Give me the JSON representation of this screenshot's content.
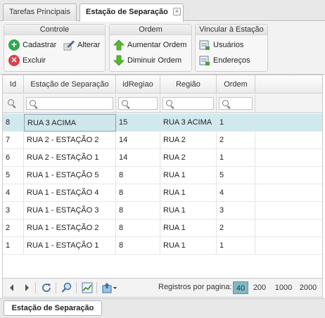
{
  "tabs": [
    {
      "label": "Tarefas Principais",
      "active": false
    },
    {
      "label": "Estação de Separação",
      "active": true,
      "close": "×"
    }
  ],
  "ribbon": {
    "controle": {
      "title": "Controle",
      "cadastrar": "Cadastrar",
      "alterar": "Alterar",
      "excluir": "Excluir"
    },
    "ordem": {
      "title": "Ordem",
      "aumentar": "Aumentar Ordem",
      "diminuir": "Diminuir Ordem"
    },
    "vincular": {
      "title": "Vincular à Estação",
      "usuarios": "Usuários",
      "enderecos": "Endereços"
    }
  },
  "grid": {
    "columns": [
      "Id",
      "Estação de Separação",
      "idRegiao",
      "Região",
      "Ordem"
    ],
    "rows": [
      {
        "id": "8",
        "estacao": "RUA 3 ACIMA",
        "idRegiao": "15",
        "regiao": "RUA 3 ACIMA",
        "ordem": "1",
        "selected": true
      },
      {
        "id": "7",
        "estacao": "RUA 2 - ESTAÇÃO 2",
        "idRegiao": "14",
        "regiao": "RUA 2",
        "ordem": "2"
      },
      {
        "id": "6",
        "estacao": "RUA 2 - ESTAÇÃO 1",
        "idRegiao": "14",
        "regiao": "RUA 2",
        "ordem": "1"
      },
      {
        "id": "5",
        "estacao": "RUA 1 - ESTAÇÃO 5",
        "idRegiao": "8",
        "regiao": "RUA 1",
        "ordem": "5"
      },
      {
        "id": "4",
        "estacao": "RUA 1 - ESTAÇÃO 4",
        "idRegiao": "8",
        "regiao": "RUA 1",
        "ordem": "4"
      },
      {
        "id": "3",
        "estacao": "RUA 1 - ESTAÇÃO 3",
        "idRegiao": "8",
        "regiao": "RUA 1",
        "ordem": "3"
      },
      {
        "id": "2",
        "estacao": "RUA 1 - ESTAÇÃO 2",
        "idRegiao": "8",
        "regiao": "RUA 1",
        "ordem": "2"
      },
      {
        "id": "1",
        "estacao": "RUA 1 - ESTAÇÃO 1",
        "idRegiao": "8",
        "regiao": "RUA 1",
        "ordem": "1"
      }
    ]
  },
  "pager": {
    "label": "Registros por pagina:",
    "sizes": [
      "40",
      "200",
      "1000",
      "2000"
    ],
    "selected_size": "40",
    "icons": [
      "prev-icon",
      "next-icon",
      "refresh-icon",
      "search-icon",
      "chart-icon",
      "export-icon"
    ]
  },
  "bottom_tab": {
    "label": "Estação de Separação"
  },
  "colors": {
    "selected_row": "#d0e9ee",
    "active_page": "#7fb9c8",
    "add_icon": "#2fa84f",
    "delete_icon": "#d9434b"
  }
}
